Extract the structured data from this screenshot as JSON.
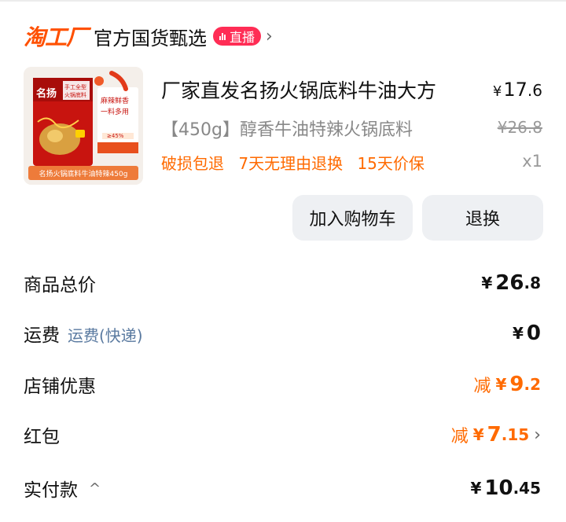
{
  "shop": {
    "logo": "淘工厂",
    "name": "官方国货甄选",
    "live_badge": "直播",
    "chevron": "›"
  },
  "product": {
    "title": "厂家直发名扬火锅底料牛油大方",
    "spec": "【450g】醇香牛油特辣火锅底料",
    "tags": [
      "破损包退",
      "7天无理由退换",
      "15天价保"
    ],
    "price_symbol": "¥",
    "price_int": "17",
    "price_dec": ".6",
    "original_price": "¥26.8",
    "quantity": "x1",
    "image": {
      "brand": "名扬",
      "label_top": "手工全型",
      "label_top2": "火锅底料",
      "side_text1": "麻辣鲜香",
      "side_text2": "一料多用",
      "side_text3": "≥45%",
      "bottom_caption": "名扬火锅底料牛油特辣450g"
    }
  },
  "actions": {
    "add_to_cart": "加入购物车",
    "return_exchange": "退换"
  },
  "summary": {
    "goods_total": {
      "label": "商品总价",
      "yen": "¥",
      "int": "26",
      "dec": ".8"
    },
    "shipping": {
      "label": "运费",
      "sub": "运费(快递)",
      "yen": "¥",
      "int": "0"
    },
    "shop_discount": {
      "label": "店铺优惠",
      "prefix": "减",
      "yen": "¥",
      "int": "9",
      "dec": ".2"
    },
    "red_packet": {
      "label": "红包",
      "prefix": "减",
      "yen": "¥",
      "int": "7",
      "dec": ".15",
      "chevron": "›"
    },
    "paid": {
      "label": "实付款",
      "caret": "^",
      "yen": "¥",
      "int": "10",
      "dec": ".45"
    }
  },
  "colors": {
    "accent_orange": "#ff6a00",
    "logo_orange": "#ff5000",
    "live_pink": "#ff2d55",
    "button_bg": "#eef0f3",
    "muted_text": "#888888",
    "link_blue": "#5a7aa0"
  }
}
